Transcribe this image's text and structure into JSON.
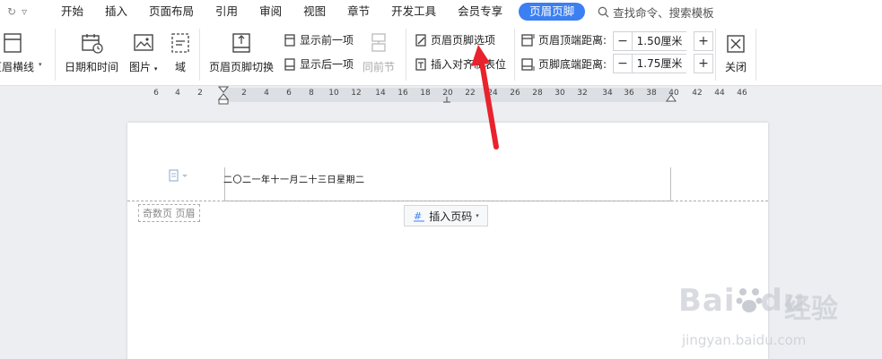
{
  "menu": {
    "items": [
      "开始",
      "插入",
      "页面布局",
      "引用",
      "审阅",
      "视图",
      "章节",
      "开发工具",
      "会员专享"
    ],
    "active": "页眉页脚",
    "search": "查找命令、搜索模板"
  },
  "ribbon": {
    "header_line": "页眉横线",
    "date_time": "日期和时间",
    "picture": "图片",
    "field": "域",
    "switch": "页眉页脚切换",
    "show_prev": "显示前一项",
    "show_next": "显示后一项",
    "same_prev": "同前节",
    "options": "页眉页脚选项",
    "insert_align_tab": "插入对齐制表位",
    "top_distance_label": "页眉顶端距离:",
    "top_distance_value": "1.50厘米",
    "bottom_distance_label": "页脚底端距离:",
    "bottom_distance_value": "1.75厘米",
    "minus": "−",
    "plus": "+",
    "close": "关闭"
  },
  "ruler": {
    "ticks": [
      "6",
      "4",
      "2",
      "2",
      "4",
      "6",
      "8",
      "10",
      "12",
      "14",
      "16",
      "18",
      "20",
      "22",
      "24",
      "26",
      "28",
      "30",
      "32",
      "34",
      "36",
      "38",
      "40",
      "42",
      "44",
      "46"
    ]
  },
  "document": {
    "header_text": "二〇二一年十一月二十三日星期二",
    "odd_page_label": "奇数页 页眉",
    "insert_page_number": "插入页码"
  },
  "watermark": {
    "main": "Bai",
    "mid": "du",
    "cn": "经验",
    "sub": "jingyan.baidu.com"
  },
  "colors": {
    "accent": "#3b7ff2",
    "arrow": "#e8232d"
  }
}
